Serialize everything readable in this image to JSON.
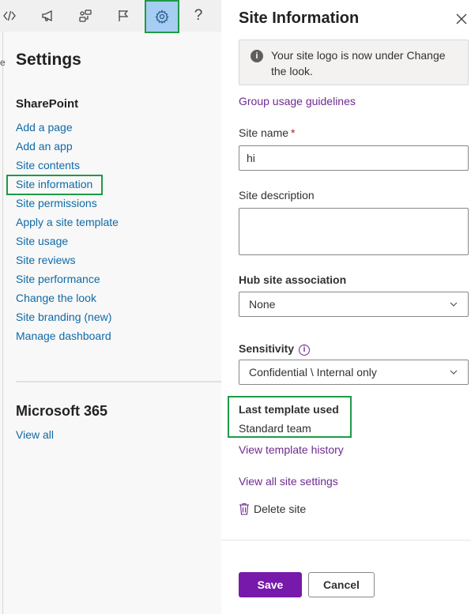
{
  "topbar": {
    "icons": [
      "code-icon",
      "megaphone-icon",
      "share-icon",
      "flag-icon",
      "gear-icon",
      "help-icon"
    ],
    "help_glyph": "?",
    "active_color": "#a6cdf2"
  },
  "left_pane": {
    "edge_glyph": "e",
    "title": "Settings",
    "sharepoint_heading": "SharePoint",
    "links": [
      "Add a page",
      "Add an app",
      "Site contents",
      "Site information",
      "Site permissions",
      "Apply a site template",
      "Site usage",
      "Site reviews",
      "Site performance",
      "Change the look",
      "Site branding (new)",
      "Manage dashboard"
    ],
    "m365_heading": "Microsoft 365",
    "view_all": "View all"
  },
  "panel": {
    "title": "Site Information",
    "info_message": "Your site logo is now under Change the look.",
    "group_link": "Group usage guidelines",
    "site_name_label": "Site name",
    "required_mark": "*",
    "site_name_value": "hi",
    "site_description_label": "Site description",
    "site_description_value": "",
    "hub_label": "Hub site association",
    "hub_value": "None",
    "sensitivity_label": "Sensitivity",
    "sensitivity_info_glyph": "i",
    "sensitivity_value": "Confidential \\ Internal only",
    "template_label": "Last template used",
    "template_value": "Standard team",
    "template_history_link": "View template history",
    "all_settings_link": "View all site settings",
    "delete_label": "Delete site",
    "save_label": "Save",
    "cancel_label": "Cancel"
  },
  "colors": {
    "link_blue": "#0f6aa6",
    "link_purple": "#6f2a8f",
    "primary_button": "#7719aa",
    "highlight_green": "#1f9a46"
  }
}
